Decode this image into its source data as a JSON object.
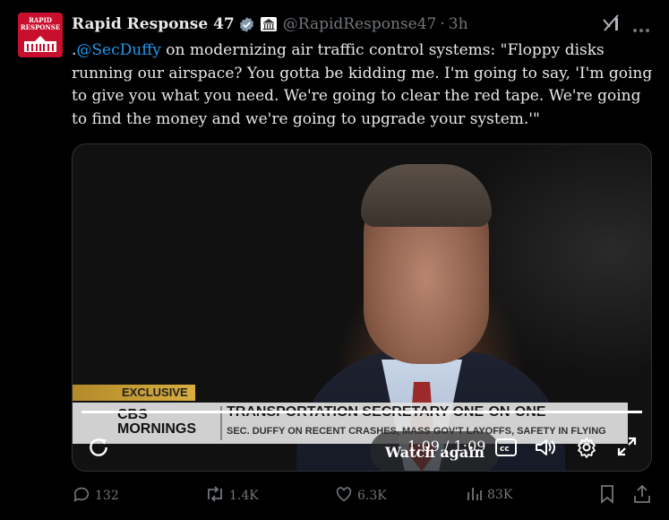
{
  "post": {
    "avatar_text_line1": "RAPID",
    "avatar_text_line2": "RESPONSE",
    "display_name": "Rapid Response 47",
    "handle": "@RapidResponse47",
    "separator": "·",
    "time": "3h",
    "text_prefix": ".",
    "mention": "@SecDuffy",
    "text_body": " on modernizing air traffic control systems: \"Floppy disks running our airspace? You gotta be kidding me. I'm going to say, 'I'm going to give you what you need. We're going to clear the red tape. We're going to find the money and we're going to upgrade your system.'\""
  },
  "video": {
    "overlay_label": "Watch again",
    "exclusive_tag": "EXCLUSIVE",
    "network_line1": "CBS",
    "network_line2": "MORNINGS",
    "headline": "TRANSPORTATION SECRETARY ONE-ON-ONE",
    "subheadline": "SEC. DUFFY ON RECENT CRASHES, MASS GOV'T LAYOFFS, SAFETY IN FLYING",
    "time_display": "1:09 / 1:09",
    "progress_fraction": 1.0
  },
  "actions": {
    "replies": "132",
    "reposts": "1.4K",
    "likes": "6.3K",
    "views": "83K"
  },
  "icons": [
    "verified-badge-icon",
    "government-building-icon",
    "grok-icon",
    "more-icon",
    "replay-icon",
    "captions-icon",
    "volume-icon",
    "settings-gear-icon",
    "fullscreen-icon",
    "reply-icon",
    "repost-icon",
    "like-icon",
    "views-icon",
    "bookmark-icon",
    "share-icon"
  ],
  "colors": {
    "accent": "#1d9bf0",
    "muted": "#71767b",
    "text": "#e7e9ea",
    "avatar_bg": "#c8102e"
  }
}
